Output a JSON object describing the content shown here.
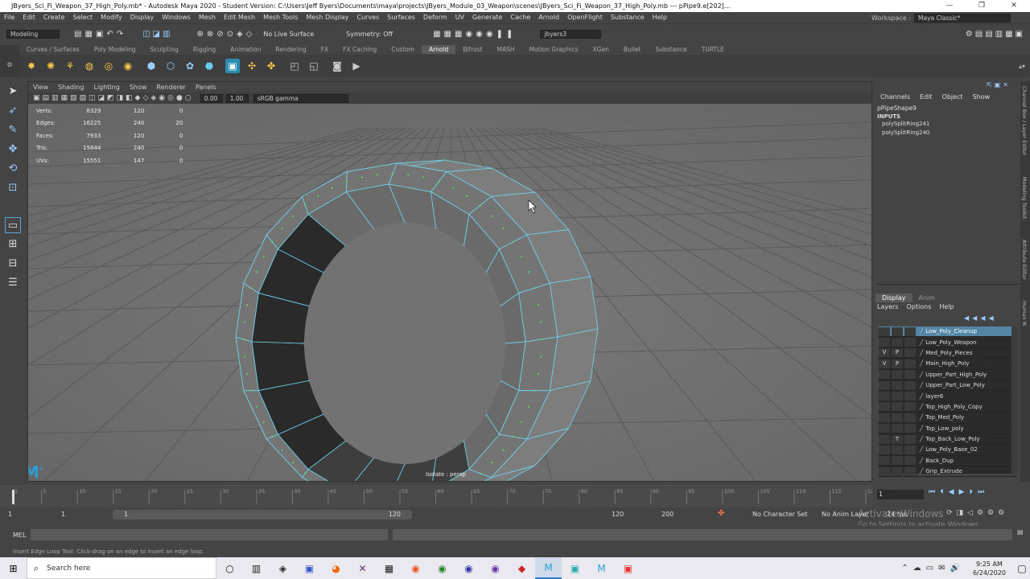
{
  "window": {
    "title": "JByers_Sci_Fi_Weapon_37_High_Poly.mb* - Autodesk Maya 2020 - Student Version: C:\\Users\\Jeff Byers\\Documents\\maya\\projects\\JByers_Module_03_Weapon\\scenes\\JByers_Sci_Fi_Weapon_37_High_Poly.mb  ---  pPipe9.e[202]...",
    "min": "—",
    "max": "❐",
    "close": "✕"
  },
  "menubar": [
    "File",
    "Edit",
    "Create",
    "Select",
    "Modify",
    "Display",
    "Windows",
    "Mesh",
    "Edit Mesh",
    "Mesh Tools",
    "Mesh Display",
    "Curves",
    "Surfaces",
    "Deform",
    "UV",
    "Generate",
    "Cache",
    "Arnold",
    "OpenFlight",
    "Substance",
    "Help"
  ],
  "workspace": {
    "label": "Workspace :",
    "value": "Maya Classic*"
  },
  "statusline": {
    "mode": "Modeling",
    "live_surface": "No Live Surface",
    "symmetry": "Symmetry: Off",
    "user": "jbyers3"
  },
  "shelf_tabs": [
    "Curves / Surfaces",
    "Poly Modeling",
    "Sculpting",
    "Rigging",
    "Animation",
    "Rendering",
    "FX",
    "FX Caching",
    "Custom",
    "Arnold",
    "Bifrost",
    "MASH",
    "Motion Graphics",
    "XGen",
    "Bullet",
    "Substance",
    "TURTLE"
  ],
  "active_shelf": "Arnold",
  "viewport": {
    "menus": [
      "View",
      "Shading",
      "Lighting",
      "Show",
      "Renderer",
      "Panels"
    ],
    "near": "0.00",
    "far": "1.00",
    "colorspace": "sRGB gamma",
    "camera_label": "Isolate : persp",
    "hud": [
      {
        "label": "Verts:",
        "a": "8329",
        "b": "120",
        "c": "0"
      },
      {
        "label": "Edges:",
        "a": "16225",
        "b": "240",
        "c": "20"
      },
      {
        "label": "Faces:",
        "a": "7933",
        "b": "120",
        "c": "0"
      },
      {
        "label": "Tris:",
        "a": "15844",
        "b": "240",
        "c": "0"
      },
      {
        "label": "UVs:",
        "a": "15551",
        "b": "147",
        "c": "0"
      }
    ]
  },
  "channel_box": {
    "menus": [
      "Channels",
      "Edit",
      "Object",
      "Show"
    ],
    "object": "pPipeShape9",
    "inputs_label": "INPUTS",
    "inputs": [
      "polySplitRing241",
      "polySplitRing240"
    ]
  },
  "side_tabs": [
    "Channel Box / Layer Editor",
    "Modeling Toolkit",
    "Attribute Editor",
    "Human IK"
  ],
  "layer_editor": {
    "tabs": [
      "Display",
      "Anim"
    ],
    "menus": [
      "Layers",
      "Options",
      "Help"
    ],
    "layers": [
      {
        "v": "",
        "p": "",
        "name": "Low_Poly_Cleanup",
        "selected": true
      },
      {
        "v": "",
        "p": "",
        "name": "Low_Poly_Weapon"
      },
      {
        "v": "V",
        "p": "P",
        "name": "Med_Poly_Pieces"
      },
      {
        "v": "V",
        "p": "P",
        "name": "Main_High_Poly"
      },
      {
        "v": "",
        "p": "",
        "name": "Upper_Part_High_Poly"
      },
      {
        "v": "",
        "p": "",
        "name": "Upper_Part_Low_Poly"
      },
      {
        "v": "",
        "p": "",
        "name": "layer6"
      },
      {
        "v": "",
        "p": "",
        "name": "Top_High_Poly_Copy"
      },
      {
        "v": "",
        "p": "",
        "name": "Top_Med_Poly"
      },
      {
        "v": "",
        "p": "",
        "name": "Top_Low_poly"
      },
      {
        "v": "",
        "p": "T",
        "name": "Top_Back_Low_Poly"
      },
      {
        "v": "",
        "p": "",
        "name": "Low_Poly_Base_02"
      },
      {
        "v": "",
        "p": "",
        "name": "Back_Dup"
      },
      {
        "v": "",
        "p": "",
        "name": "Grip_Extrude"
      }
    ]
  },
  "timeline": {
    "ticks": [
      "1",
      "5",
      "10",
      "15",
      "20",
      "25",
      "30",
      "35",
      "40",
      "45",
      "50",
      "55",
      "60",
      "65",
      "70",
      "75",
      "80",
      "85",
      "90",
      "95",
      "100",
      "105",
      "110",
      "115",
      "120"
    ],
    "current": "1",
    "range_start": "1",
    "range_inner_start": "1",
    "range_slider_start": "1",
    "range_slider_end": "120",
    "range_end": "120",
    "range_max": "200",
    "char_set": "No Character Set",
    "anim_layer": "No Anim Layer",
    "fps": "24 fps"
  },
  "command": {
    "lang": "MEL"
  },
  "help_line": "Insert Edge Loop Tool: Click-drag on an edge to insert an edge loop.",
  "activate": {
    "title": "Activate Windows",
    "sub": "Go to Settings to activate Windows."
  },
  "taskbar": {
    "search": "Search here",
    "time": "9:25 AM",
    "date": "6/24/2020"
  },
  "colors": {
    "wire": "#6fd6ee",
    "selected_layer": "#5285a6"
  }
}
